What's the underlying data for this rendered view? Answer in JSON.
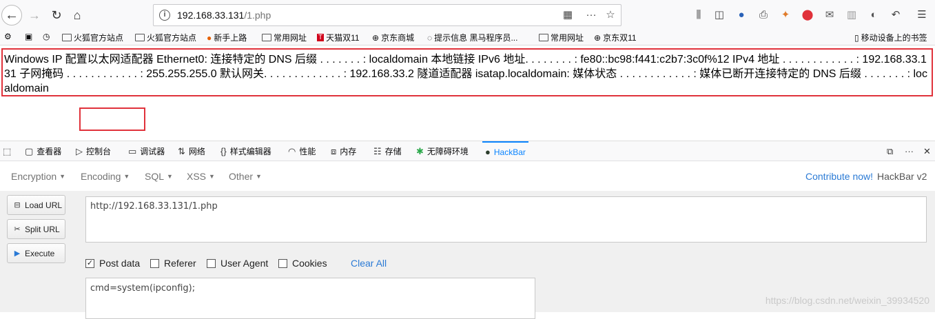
{
  "browser": {
    "url_host": "192.168.33.131",
    "url_path": "/1.php",
    "bookmarks": [
      {
        "label": "火狐官方站点",
        "icon": "folder-icon"
      },
      {
        "label": "火狐官方站点",
        "icon": "folder-icon"
      },
      {
        "label": "新手上路",
        "icon": "firefox-icon"
      },
      {
        "label": "常用网址",
        "icon": "folder-icon"
      },
      {
        "label": "天猫双11",
        "icon": "tmall-icon"
      },
      {
        "label": "京东商城",
        "icon": "globe-icon"
      },
      {
        "label": "提示信息 黑马程序员...",
        "icon": "page-icon"
      },
      {
        "label": "常用网址",
        "icon": "folder-icon"
      },
      {
        "label": "京东双11",
        "icon": "globe-icon"
      }
    ],
    "mobile_bookmarks": "移动设备上的书签"
  },
  "page": {
    "output": "Windows IP 配置以太网适配器 Ethernet0: 连接特定的 DNS 后缀 . . . . . . . : localdomain 本地链接 IPv6 地址. . . . . . . . : fe80::bc98:f441:c2b7:3c0f%12 IPv4 地址 . . . . . . . . . . . . : 192.168.33.131 子网掩码 . . . . . . . . . . . . : 255.255.255.0 默认网关. . . . . . . . . . . . . : 192.168.33.2 隧道适配器 isatap.localdomain: 媒体状态 . . . . . . . . . . . . : 媒体已断开连接特定的 DNS 后缀 . . . . . . . : localdomain"
  },
  "devtools": {
    "tabs": [
      "查看器",
      "控制台",
      "调试器",
      "网络",
      "样式编辑器",
      "性能",
      "内存",
      "存储",
      "无障碍环境",
      "HackBar"
    ],
    "active_tab": "HackBar"
  },
  "hackbar": {
    "menus": [
      "Encryption",
      "Encoding",
      "SQL",
      "XSS",
      "Other"
    ],
    "contribute": "Contribute now!",
    "version": "HackBar v2",
    "buttons": {
      "load": "Load URL",
      "split": "Split URL",
      "execute": "Execute"
    },
    "url_value": "http://192.168.33.131/1.php",
    "checkboxes": [
      {
        "label": "Post data",
        "checked": true
      },
      {
        "label": "Referer",
        "checked": false
      },
      {
        "label": "User Agent",
        "checked": false
      },
      {
        "label": "Cookies",
        "checked": false
      }
    ],
    "clear_all": "Clear All",
    "post_value": "cmd=system(ipconfig);"
  },
  "watermark": "https://blog.csdn.net/weixin_39934520",
  "colors": {
    "highlight": "#e0313a",
    "link": "#0a84ff",
    "hb_link": "#2a7ad5"
  }
}
